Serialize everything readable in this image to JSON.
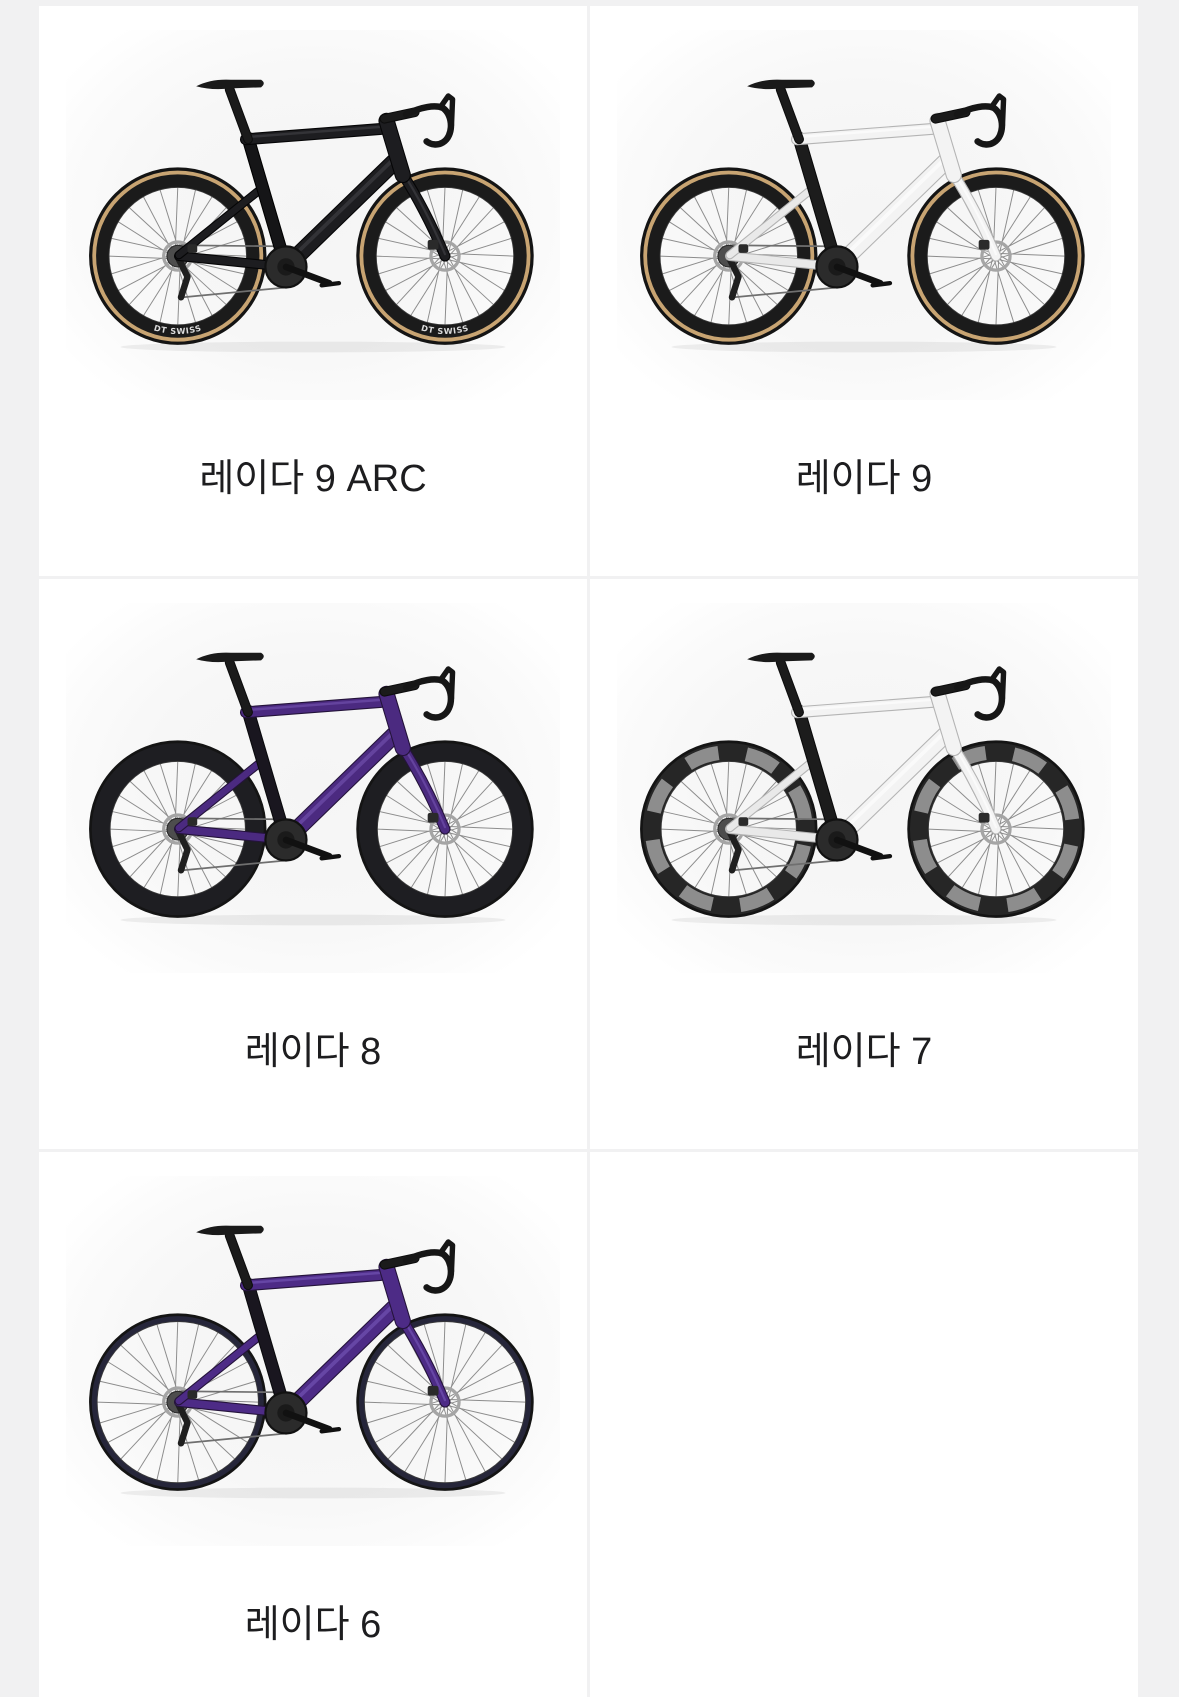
{
  "products": [
    {
      "name": "레이다 9 ARC",
      "frame_color": "#1d1d20",
      "rim_decal": "DT SWISS"
    },
    {
      "name": "레이다 9",
      "frame_color": "#f3f3f3"
    },
    {
      "name": "레이다 8",
      "frame_color": "#4b2a80"
    },
    {
      "name": "레이다 7",
      "frame_color": "#f3f3f3"
    },
    {
      "name": "레이다 6",
      "frame_color": "#4d2b86"
    }
  ],
  "colors": {
    "page_background": "#f1f1f2",
    "card_background": "#ffffff",
    "label_text": "#1d1d1f"
  }
}
